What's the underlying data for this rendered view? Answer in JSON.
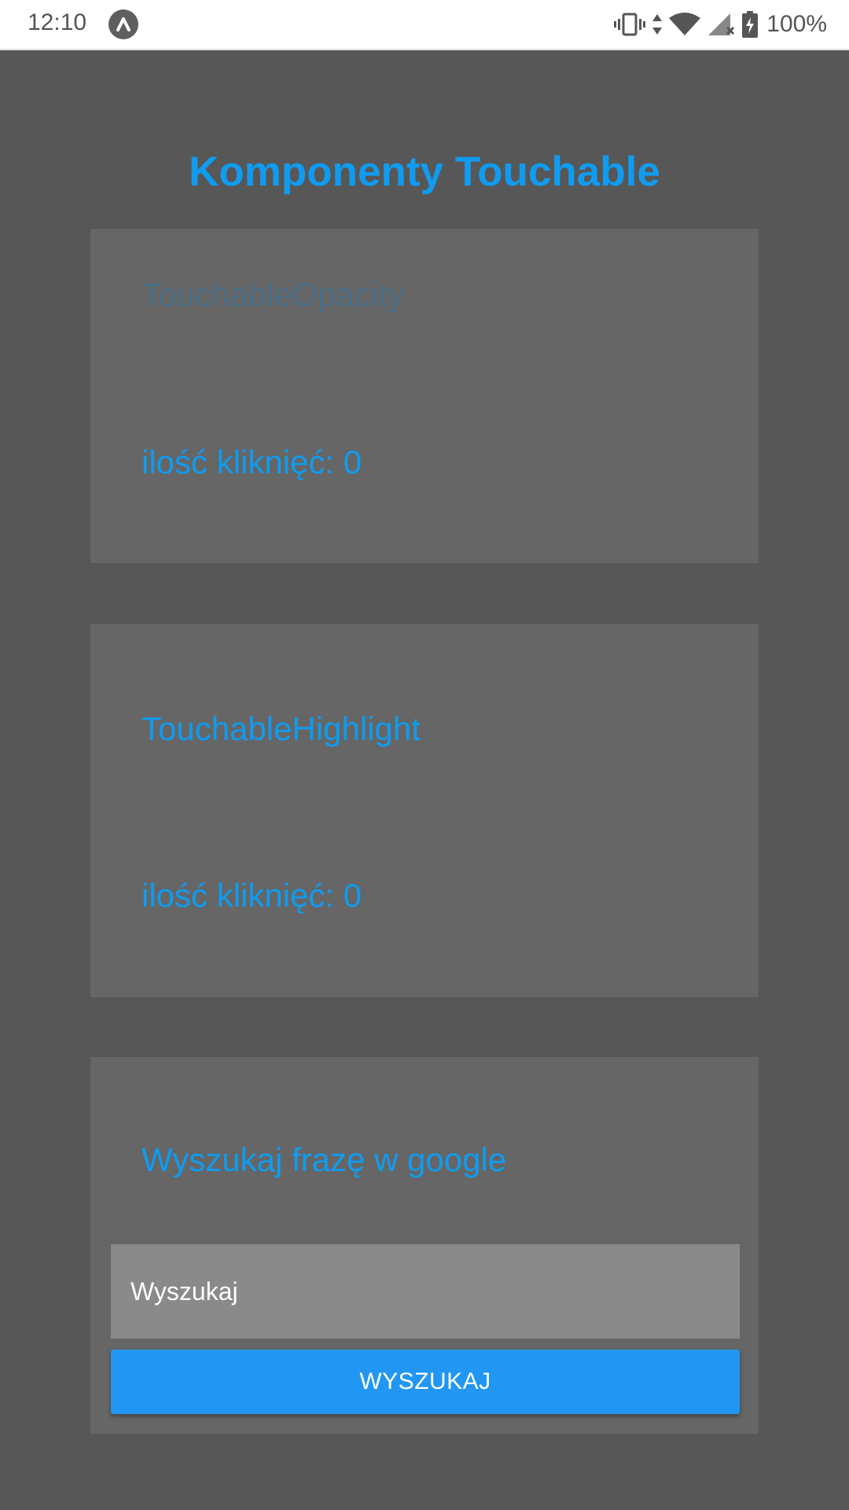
{
  "status_bar": {
    "time": "12:10",
    "battery": "100%",
    "icons": [
      "app-notification-icon",
      "vibrate-icon",
      "data-arrows-icon",
      "wifi-icon",
      "signal-icon",
      "battery-charging-icon"
    ]
  },
  "colors": {
    "background": "#575757",
    "card": "#666666",
    "accent": "#0f9cf0",
    "faded_label": "#4a6d85",
    "button": "#2196f3",
    "input": "#8a8a8a"
  },
  "page": {
    "title": "Komponenty Touchable"
  },
  "opacity_card": {
    "label": "TouchableOpacity",
    "count_text": "ilość kliknięć: 0"
  },
  "highlight_card": {
    "label": "TouchableHighlight",
    "count_text": "ilość kliknięć:  0"
  },
  "search_card": {
    "label": "Wyszukaj frazę w google",
    "input_placeholder": "Wyszukaj",
    "input_value": "",
    "button_label": "WYSZUKAJ"
  }
}
